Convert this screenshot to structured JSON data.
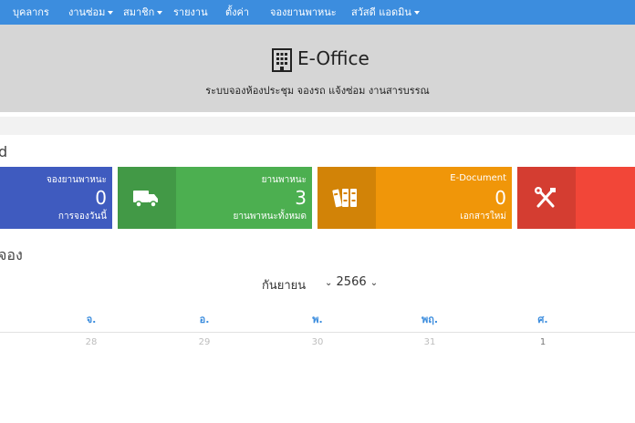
{
  "nav": {
    "personnel": "บุคลากร",
    "repair": "งานซ่อม",
    "member": "สมาชิก",
    "report": "รายงาน",
    "settings": "ตั้งค่า",
    "vehicle_booking": "จองยานพาหนะ",
    "user": "สวัสดี แอดมิน"
  },
  "hero": {
    "title": "E-Office",
    "subtitle": "ระบบจองห้องประชุม จองรถ แจ้งซ่อม งานสารบรรณ",
    "icon": "building-icon"
  },
  "dashboard": {
    "title_partial": "d"
  },
  "cards": [
    {
      "title": "จองยานพาหนะ",
      "number": "0",
      "sub": "การจองวันนี้",
      "color": "#3f5bbf",
      "icon": ""
    },
    {
      "title": "ยานพาหนะ",
      "number": "3",
      "sub": "ยานพาหนะทั้งหมด",
      "color": "#4caf50",
      "icon": "truck-icon"
    },
    {
      "title": "E-Document",
      "number": "0",
      "sub": "เอกสารใหม่",
      "color": "#f09609",
      "icon": "binders-icon"
    },
    {
      "title": "",
      "number": "",
      "sub": "",
      "color": "#f24638",
      "icon": "tools-icon"
    }
  ],
  "calendar": {
    "section_title": "จอง",
    "month": "กันยายน",
    "year": "2566",
    "weekdays": [
      "จ.",
      "อ.",
      "พ.",
      "พฤ.",
      "ศ."
    ],
    "days": [
      "28",
      "29",
      "30",
      "31",
      "1"
    ],
    "day_colors": [
      "#bdbdbd",
      "#bdbdbd",
      "#bdbdbd",
      "#bdbdbd",
      "#777777"
    ]
  },
  "colors": {
    "navbar": "#3c8dde",
    "hero_bg": "#d6d6d6",
    "weekday_text": "#3c8dde"
  }
}
